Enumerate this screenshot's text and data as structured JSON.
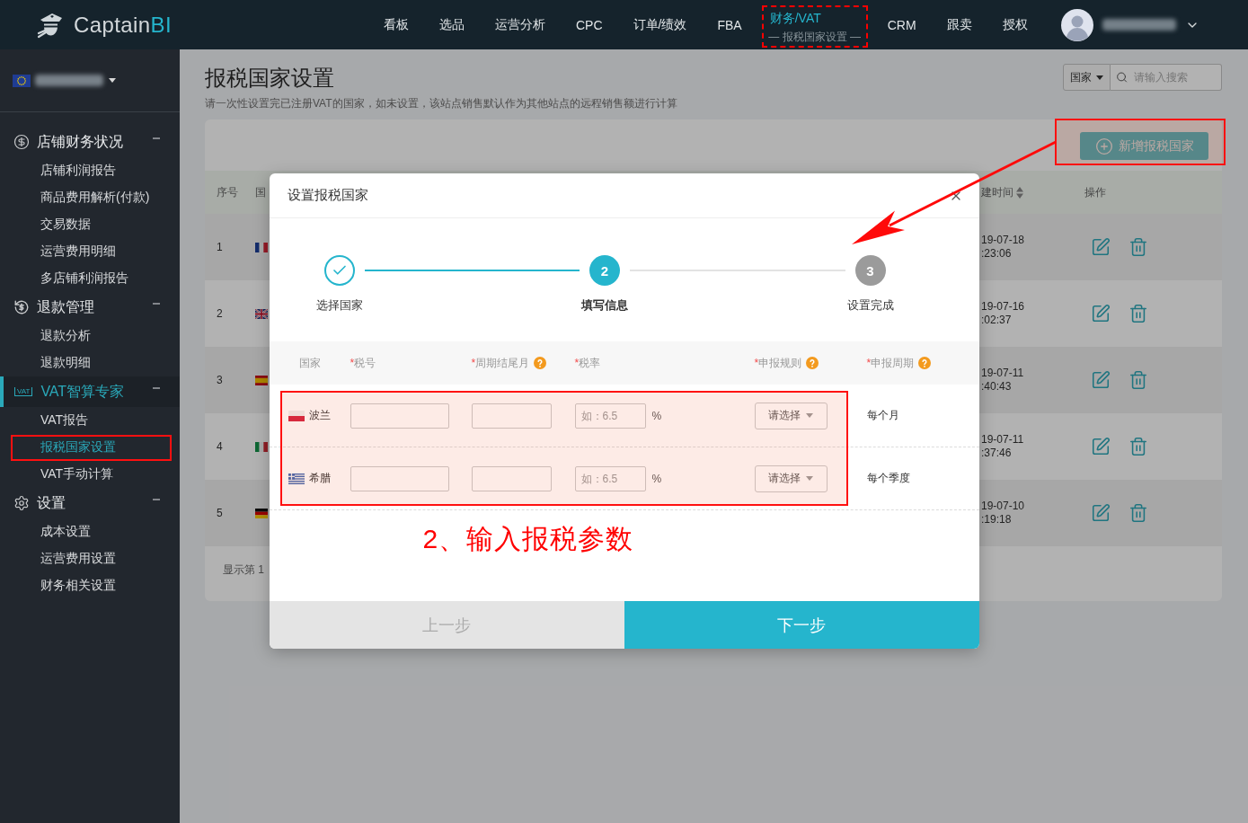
{
  "top_nav": {
    "logo": {
      "name": "Captain",
      "accent": "BI"
    },
    "items": [
      {
        "label": "看板",
        "selected": false
      },
      {
        "label": "选品",
        "selected": false
      },
      {
        "label": "运营分析",
        "selected": false
      },
      {
        "label": "CPC",
        "selected": false
      },
      {
        "label": "订单/绩效",
        "selected": false
      },
      {
        "label": "FBA",
        "selected": false
      },
      {
        "label": "财务/VAT",
        "selected": true,
        "sublabel": "— 报税国家设置 —",
        "highlighted": true
      },
      {
        "label": "CRM",
        "selected": false
      },
      {
        "label": "跟卖",
        "selected": false
      },
      {
        "label": "授权",
        "selected": false
      }
    ]
  },
  "sidebar": {
    "sections": [
      {
        "title": "店铺财务状况",
        "selected": false,
        "expanded": true,
        "items": [
          {
            "label": "店铺利润报告",
            "selected": false
          },
          {
            "label": "商品费用解析(付款)",
            "selected": false
          },
          {
            "label": "交易数据",
            "selected": false
          },
          {
            "label": "运营费用明细",
            "selected": false
          },
          {
            "label": "多店铺利润报告",
            "selected": false
          }
        ]
      },
      {
        "title": "退款管理",
        "selected": false,
        "expanded": true,
        "items": [
          {
            "label": "退款分析",
            "selected": false
          },
          {
            "label": "退款明细",
            "selected": false
          }
        ]
      },
      {
        "title": "VAT智算专家",
        "icon_label": "VAT",
        "selected": true,
        "expanded": true,
        "items": [
          {
            "label": "VAT报告",
            "selected": false
          },
          {
            "label": "报税国家设置",
            "selected": true,
            "highlighted": true
          },
          {
            "label": "VAT手动计算",
            "selected": false
          }
        ]
      },
      {
        "title": "设置",
        "selected": false,
        "expanded": true,
        "items": [
          {
            "label": "成本设置",
            "selected": false
          },
          {
            "label": "运营费用设置",
            "selected": false
          },
          {
            "label": "财务相关设置",
            "selected": false
          }
        ]
      }
    ]
  },
  "page": {
    "title": "报税国家设置",
    "subtitle": "请一次性设置完已注册VAT的国家，如未设置，该站点销售默认作为其他站点的远程销售额进行计算",
    "search": {
      "scope": "国家",
      "placeholder": "请输入搜索"
    },
    "add_button": {
      "label": "新增报税国家",
      "highlighted": true
    },
    "table": {
      "columns": [
        {
          "label": "序号"
        },
        {
          "label": "国"
        },
        {
          "label": "建时间",
          "sortable": true
        },
        {
          "label": "操作"
        }
      ],
      "rows": [
        {
          "index": "1",
          "date": "19-07-18",
          "time": ":23:06"
        },
        {
          "index": "2",
          "date": "19-07-16",
          "time": ":02:37"
        },
        {
          "index": "3",
          "date": "19-07-11",
          "time": ":40:43"
        },
        {
          "index": "4",
          "date": "19-07-11",
          "time": ":37:46"
        },
        {
          "index": "5",
          "date": "19-07-10",
          "time": ":19:18"
        }
      ],
      "footer": "显示第 1"
    }
  },
  "modal": {
    "title": "设置报税国家",
    "steps": [
      {
        "label": "选择国家",
        "completed": true,
        "selected": false
      },
      {
        "label": "填写信息",
        "number": "2",
        "completed": false,
        "selected": true
      },
      {
        "label": "设置完成",
        "number": "3",
        "completed": false,
        "selected": false
      }
    ],
    "form": {
      "highlighted": true,
      "columns": [
        {
          "label": "国家",
          "help": false
        },
        {
          "required_mark": "*",
          "label": "税号",
          "help": false
        },
        {
          "required_mark": "*",
          "label": "周期结尾月",
          "help": true
        },
        {
          "required_mark": "*",
          "label": "税率",
          "help": false
        },
        {
          "required_mark": "*",
          "label": "申报规则",
          "help": true
        },
        {
          "required_mark": "*",
          "label": "申报周期",
          "help": true
        }
      ],
      "rows": [
        {
          "country": "波兰",
          "rate_placeholder": "如：6.5",
          "rate_unit": "%",
          "rule_select": "请选择",
          "period": "每个月"
        },
        {
          "country": "希腊",
          "rate_placeholder": "如：6.5",
          "rate_unit": "%",
          "rule_select": "请选择",
          "period": "每个季度"
        }
      ]
    },
    "annotation": "2、输入报税参数",
    "buttons": {
      "prev": {
        "label": "上一步",
        "disabled": true
      },
      "next": {
        "label": "下一步"
      }
    }
  }
}
